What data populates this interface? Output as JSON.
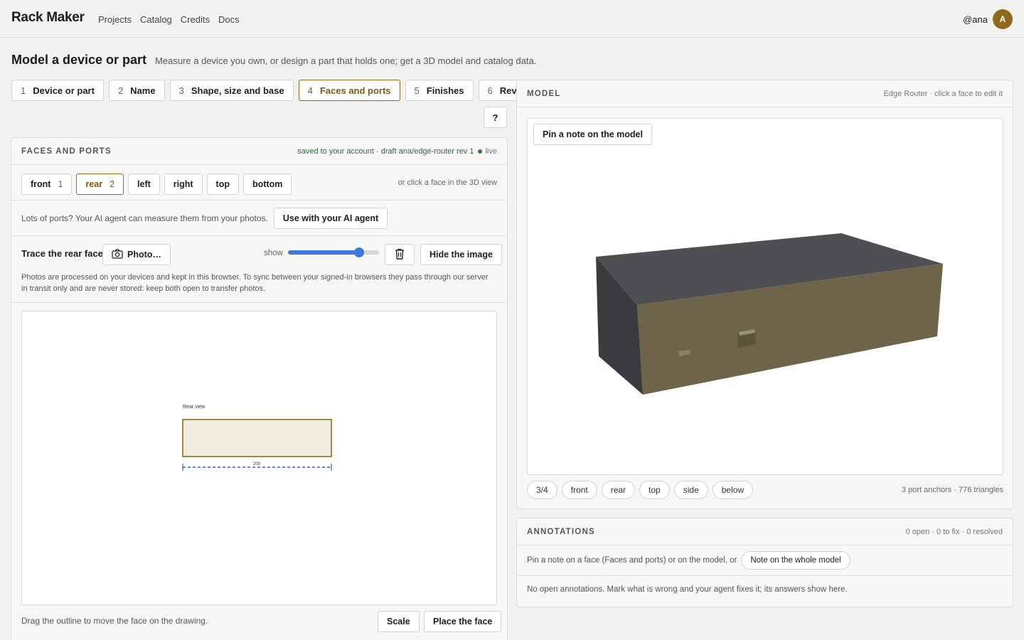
{
  "app": {
    "brand": "Rack Maker",
    "nav": [
      "Projects",
      "Catalog",
      "Credits",
      "Docs"
    ],
    "username": "@ana",
    "avatar_initial": "A",
    "accent_color": "#8e6a1a"
  },
  "page": {
    "title": "Model a device or part",
    "subtitle": "Measure a device you own, or design a part that holds one; get a 3D model and catalog data."
  },
  "steps": [
    {
      "num": "1",
      "label": "Device or part"
    },
    {
      "num": "2",
      "label": "Name"
    },
    {
      "num": "3",
      "label": "Shape, size and base"
    },
    {
      "num": "4",
      "label": "Faces and ports",
      "active": true
    },
    {
      "num": "5",
      "label": "Finishes"
    },
    {
      "num": "6",
      "label": "Review"
    }
  ],
  "help_label": "?",
  "faces": {
    "panel_label": "FACES AND PORTS",
    "saved_text": "saved to your account · draft ana/edge-router rev 1",
    "live_label": "live",
    "tabs": [
      {
        "label": "front",
        "count": "1"
      },
      {
        "label": "rear",
        "count": "2",
        "active": true
      },
      {
        "label": "left",
        "count": ""
      },
      {
        "label": "right",
        "count": ""
      },
      {
        "label": "top",
        "count": ""
      },
      {
        "label": "bottom",
        "count": ""
      }
    ],
    "face_hint": "or click a face in the 3D view",
    "agent_text": "Lots of ports? Your AI agent can measure them from your photos.",
    "agent_button": "Use with your AI agent",
    "trace_label": "Trace the rear face",
    "photo_button": "Photo…",
    "show_label": "show",
    "show_opacity": 0.82,
    "hide_button": "Hide the image",
    "privacy_note": "Photos are processed on your devices and kept in this browser. To sync between your signed-in browsers they pass through our server in transit only and are never stored: keep both open to transfer photos.",
    "drawing_label": "Rear view",
    "drawing_dimension": "200",
    "drag_hint": "Drag the outline to move the face on the drawing.",
    "scale_button": "Scale",
    "place_button": "Place the face"
  },
  "model": {
    "panel_label": "MODEL",
    "header_hint": "Edge Router · click a face to edit it",
    "pin_button": "Pin a note on the model",
    "views": [
      "3/4",
      "front",
      "rear",
      "top",
      "side",
      "below"
    ],
    "stats": "3 port anchors · 776 triangles"
  },
  "annotations": {
    "panel_label": "ANNOTATIONS",
    "counts": "0 open · 0 to fix · 0 resolved",
    "pin_text": "Pin a note on a face (Faces and ports) or on the model, or",
    "whole_model_button": "Note on the whole model",
    "empty_text": "No open annotations. Mark what is wrong and your agent fixes it; its answers show here."
  }
}
